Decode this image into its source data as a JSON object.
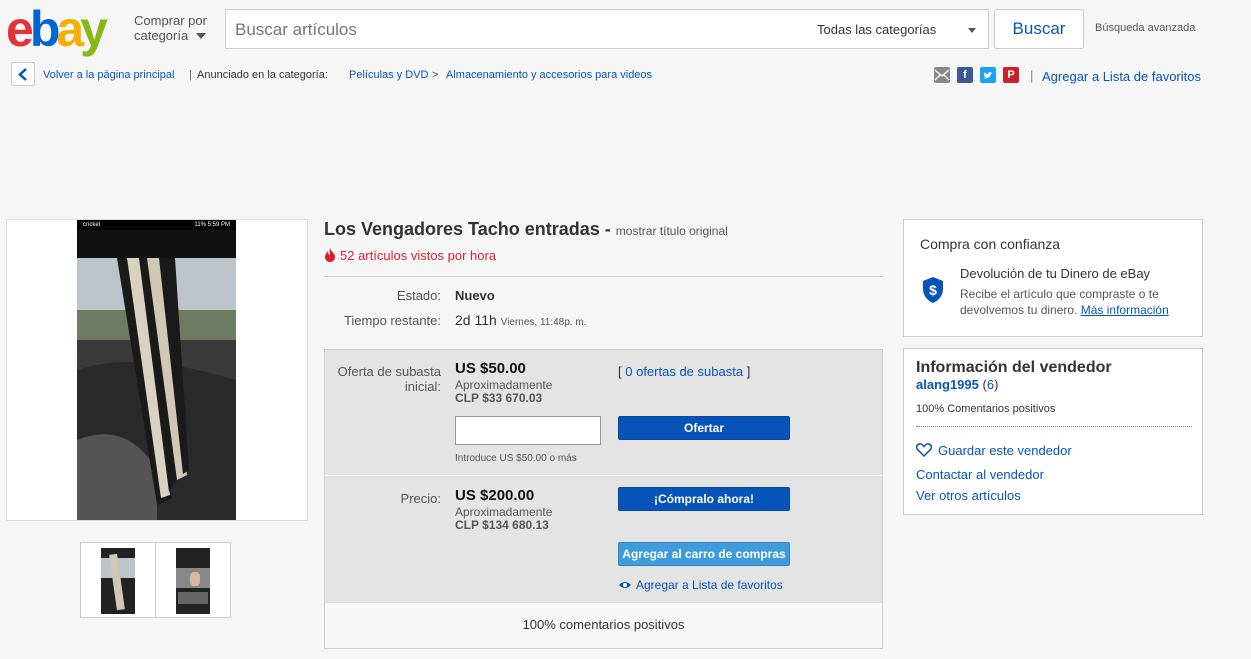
{
  "header": {
    "shop_by_line1": "Comprar por",
    "shop_by_line2": "categoría",
    "search_placeholder": "Buscar artículos",
    "category_select": "Todas las categorías",
    "search_button": "Buscar",
    "advanced_search": "Búsqueda avanzada"
  },
  "breadcrumb": {
    "back_label": "Volver a la página principal",
    "listed_in": "Anunciado en la categoría:",
    "cat1": "Películas y DVD",
    "sep": ">",
    "cat2": "Almacenamiento y accesorios para videos",
    "watchlist": "Agregar a Lista de favoritos",
    "pipe": "|"
  },
  "listing": {
    "title": "Los Vengadores Tacho entradas",
    "title_dash": "-",
    "show_original": "mostrar título original",
    "views": "52 artículos vistos por hora",
    "condition_label": "Estado:",
    "condition_value": "Nuevo",
    "time_left_label": "Tiempo restante:",
    "time_left_value": "2d 11h",
    "time_left_detail": "Viernes, 11:48p. m."
  },
  "auction": {
    "label": "Oferta de subasta inicial:",
    "label_line1": "Oferta de subasta",
    "label_line2": "inicial:",
    "price": "US $50.00",
    "approx": "Aproximadamente",
    "approx_clp": "CLP $33 670.03",
    "bids_open": "[",
    "bids_link": "0 ofertas de subasta",
    "bids_close": "]",
    "bid_button": "Ofertar",
    "bid_hint": "Introduce US $50.00 o más"
  },
  "buy_now": {
    "label": "Precio:",
    "price": "US $200.00",
    "approx": "Aproximadamente",
    "approx_clp": "CLP $134 680.13",
    "buy_button": "¡Cómpralo ahora!",
    "cart_button": "Agregar al carro de compras",
    "watch_link": "Agregar a Lista de favoritos"
  },
  "footer_feedback": "100% comentarios positivos",
  "confidence": {
    "title": "Compra con confianza",
    "heading": "Devolución de tu Dinero de eBay",
    "text_line1": "Recibe el artículo que compraste o te",
    "text_line2": "devolvemos tu dinero.",
    "more_info": "Más información"
  },
  "seller": {
    "title": "Información del vendedor",
    "name": "alang1995",
    "score_open": "(",
    "score": "6",
    "score_close": ")",
    "feedback": "100% Comentarios positivos",
    "save": "Guardar este vendedor",
    "contact": "Contactar al vendedor",
    "other_items": "Ver otros artículos"
  },
  "photo": {
    "status_carrier": "cricket",
    "status_right": "11% 5:59 PM"
  },
  "colors": {
    "ebay_e": "#e53238",
    "ebay_b": "#0064d2",
    "ebay_a": "#f5af02",
    "ebay_y": "#86b817",
    "link_blue": "#0654ba",
    "views_red": "#dd1e31",
    "button_blue": "#0654ba"
  },
  "icons": [
    "back-chevron-icon",
    "email-icon",
    "facebook-icon",
    "twitter-icon",
    "pinterest-icon",
    "fire-icon",
    "shield-dollar-icon",
    "heart-icon",
    "eye-icon",
    "dropdown-caret-icon"
  ]
}
